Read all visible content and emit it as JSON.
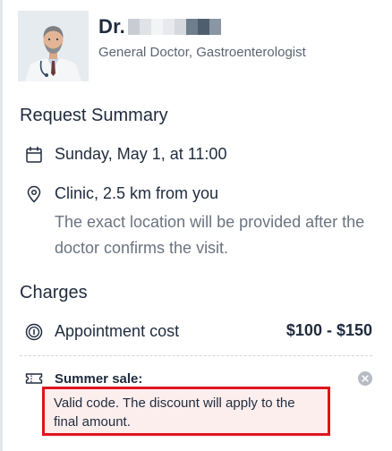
{
  "doctor": {
    "name": "Dr.",
    "specialty": "General Doctor, Gastroenterologist"
  },
  "request_summary": {
    "title": "Request Summary",
    "datetime": "Sunday, May 1, at 11:00",
    "location": "Clinic, 2.5 km from you",
    "location_note": "The exact location will be provided after the doctor confirms the visit."
  },
  "charges": {
    "title": "Charges",
    "appointment_label": "Appointment cost",
    "appointment_price": "$100 - $150",
    "promo_label": "Summer sale:",
    "promo_message": "Valid code. The discount will apply to the final amount."
  },
  "icons": {
    "calendar": "calendar-icon",
    "location": "location-pin-icon",
    "cost": "coin-icon",
    "promo": "ticket-icon",
    "clear": "close-circle-icon"
  },
  "colors": {
    "text_primary": "#1f2b3d",
    "text_secondary": "#6b7380",
    "error_border": "#e0141e",
    "error_background": "#fdeeee"
  }
}
